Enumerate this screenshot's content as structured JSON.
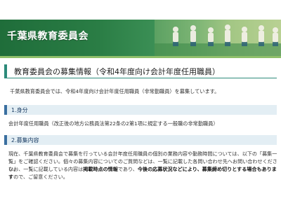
{
  "header": {
    "title": "千葉県教育委員会"
  },
  "page": {
    "title": "教育委員会の募集情報（令和4年度向け会計年度任用職員）",
    "intro": "千葉県教育委員会では、令和4年度向け会計年度任用職員（非常勤職員）を募集しています。"
  },
  "sections": [
    {
      "heading": "1.身分",
      "text": "会計年度任用職員（改正後の地方公務員法第22条の2第1項に規定する一般職の非常勤職員）"
    },
    {
      "heading": "2.募集内容",
      "paragraph1": "現在、千葉県教育委員会で募集を行っている会計年度任用職員の個別の業務内容や勤務時間については、以下の「募集一覧」をご確認ください。個々の募集内容についてのご質問などは、一覧に記載した各問い合わせ先へお問い合わせください。",
      "paragraph2_a": "なお、一覧に記載している内容は",
      "paragraph2_bold1": "掲載時点の情報",
      "paragraph2_b": "であり、",
      "paragraph2_bold2": "今後の応募状況などにより、募集締め切りとする場合もあります",
      "paragraph2_c": "ので、ご留意ください。"
    }
  ],
  "colors": {
    "banner_green": "#2a7d45",
    "title_accent": "#2c8a7a",
    "section_bg": "#e3eef4",
    "section_accent": "#3a6fa0"
  }
}
